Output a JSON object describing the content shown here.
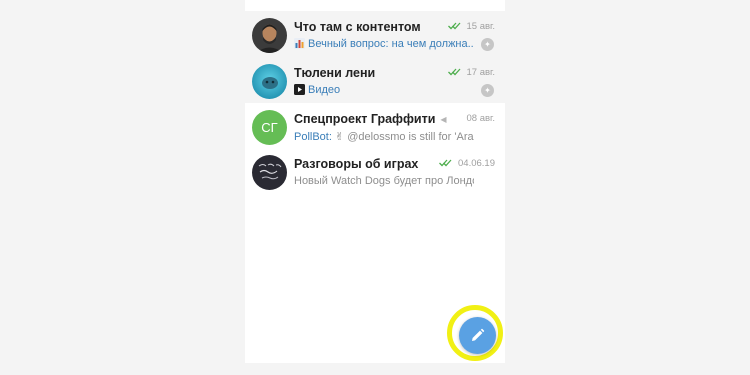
{
  "chats": [
    {
      "name": "Что там с контентом",
      "date": "15 авг.",
      "preview": "Вечный вопрос: на чем должна...",
      "preview_icon": "chart-icon",
      "read": true,
      "pinned": true
    },
    {
      "name": "Тюлени лени",
      "date": "17 авг.",
      "preview": "Видео",
      "preview_icon": "video-icon",
      "read": true,
      "pinned": true
    },
    {
      "name": "Спецпроект Граффити",
      "avatar_initials": "СГ",
      "date": "08 авг.",
      "sender": "PollBot:",
      "preview": "✌ @delossmo is still for 'Ara'. /r...",
      "muted": true,
      "avatar_color": "#65bd55"
    },
    {
      "name": "Разговоры об играх",
      "date": "04.06.19",
      "preview": "Новый Watch Dogs будет про Лондон,...",
      "read": true
    }
  ],
  "fab": {
    "icon": "pencil-icon",
    "color": "#5aa1e3",
    "highlight_color": "#f1f014"
  },
  "colors": {
    "accent": "#3a7eb8",
    "check": "#4fae4e",
    "pinned_bg": "#f4f4f4"
  }
}
